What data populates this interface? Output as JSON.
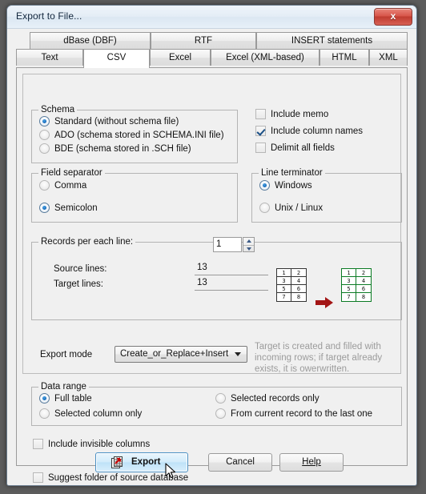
{
  "window": {
    "title": "Export to File...",
    "close_label": "x"
  },
  "tabs": {
    "row_top": [
      {
        "label": "dBase (DBF)",
        "active": false
      },
      {
        "label": "RTF",
        "active": false
      },
      {
        "label": "INSERT statements",
        "active": false
      }
    ],
    "row_bottom": [
      {
        "label": "Text",
        "active": false
      },
      {
        "label": "CSV",
        "active": true
      },
      {
        "label": "Excel",
        "active": false
      },
      {
        "label": "Excel (XML-based)",
        "active": false
      },
      {
        "label": "HTML",
        "active": false
      },
      {
        "label": "XML",
        "active": false
      }
    ]
  },
  "schema": {
    "legend": "Schema",
    "options": [
      {
        "label": "Standard (without schema file)",
        "selected": true
      },
      {
        "label": "ADO (schema stored in SCHEMA.INI file)",
        "selected": false
      },
      {
        "label": "BDE (schema stored in .SCH file)",
        "selected": false
      }
    ]
  },
  "flags": {
    "include_memo": {
      "label": "Include memo",
      "checked": false
    },
    "include_column_names": {
      "label": "Include column names",
      "checked": true
    },
    "delimit_all_fields": {
      "label": "Delimit all fields",
      "checked": false
    }
  },
  "field_separator": {
    "legend": "Field separator",
    "options": [
      {
        "label": "Comma",
        "selected": false
      },
      {
        "label": "Semicolon",
        "selected": true
      }
    ]
  },
  "line_terminator": {
    "legend": "Line terminator",
    "options": [
      {
        "label": "Windows",
        "selected": true
      },
      {
        "label": "Unix / Linux",
        "selected": false
      }
    ]
  },
  "records": {
    "legend": "Records per each line:",
    "value": "1",
    "source_lines_label": "Source lines:",
    "source_lines_value": "13",
    "target_lines_label": "Target lines:",
    "target_lines_value": "13",
    "source_grid": [
      "1",
      "2",
      "3",
      "4",
      "5",
      "6",
      "7",
      "8"
    ],
    "target_grid": [
      "1",
      "2",
      "3",
      "4",
      "5",
      "6",
      "7",
      "8"
    ],
    "arrow_color": "#a31515",
    "target_grid_color": "#0a7a23"
  },
  "export_mode": {
    "label": "Export mode",
    "value": "Create_or_Replace+Insert",
    "description": "Target is created and filled with incoming rows; if target already exists, it is owerwritten."
  },
  "data_range": {
    "legend": "Data range",
    "options": [
      {
        "label": "Full table",
        "selected": true
      },
      {
        "label": "Selected records only",
        "selected": false
      },
      {
        "label": "Selected column only",
        "selected": false
      },
      {
        "label": "From current record to the last one",
        "selected": false
      }
    ]
  },
  "bottom_flags": {
    "include_invisible_columns": {
      "label": "Include invisible columns",
      "checked": false
    },
    "suggest_folder": {
      "label": "Suggest folder of source database",
      "checked": false
    }
  },
  "buttons": {
    "export": "Export",
    "cancel": "Cancel",
    "help": "Help"
  }
}
